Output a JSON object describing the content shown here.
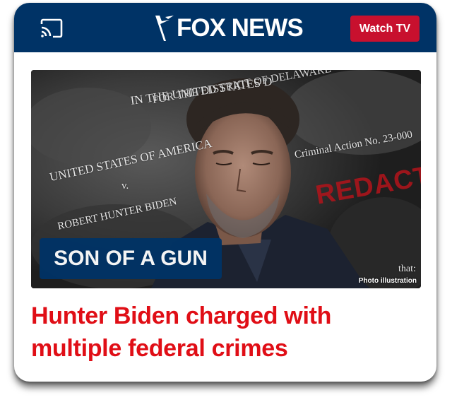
{
  "header": {
    "logo_text": "FOX NEWS",
    "watch_button_label": "Watch TV",
    "brand_color": "#003366",
    "accent_color": "#c8102e",
    "cast_icon": "cast-icon"
  },
  "hero": {
    "label": "SON OF A GUN",
    "photo_credit": "Photo illustration",
    "document_text": {
      "line1": "IN THE UNITED STATES D",
      "line2": "FOR THE DISTRICT OF DELAWARE",
      "line3": "UNITED STATES OF AMERICA",
      "line4": "v.",
      "line5": "ROBERT HUNTER BIDEN",
      "line6": "Criminal Action No. 23-000",
      "redacted": "REDACTED",
      "corner": "that:"
    }
  },
  "headline": {
    "line1": "Hunter Biden charged with",
    "line2": "multiple federal crimes",
    "color": "#e00e16"
  }
}
